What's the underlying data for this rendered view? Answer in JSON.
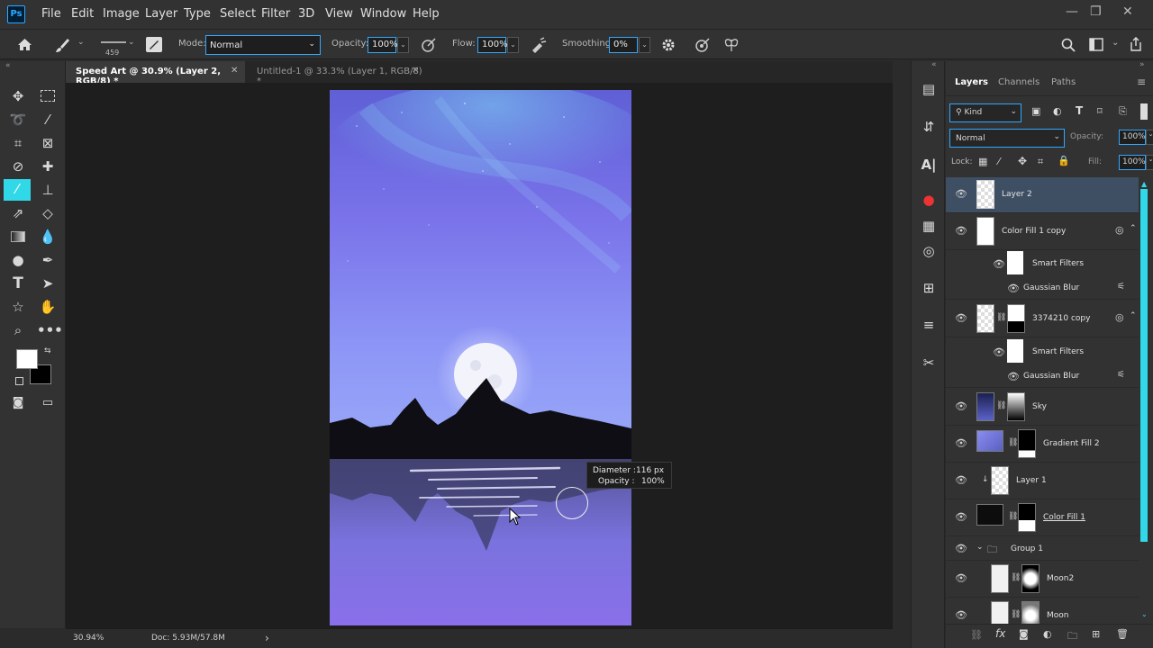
{
  "app": {
    "logo": "Ps"
  },
  "menu": [
    "File",
    "Edit",
    "Image",
    "Layer",
    "Type",
    "Select",
    "Filter",
    "3D",
    "View",
    "Window",
    "Help"
  ],
  "window_controls": {
    "minimize": "—",
    "restore": "❐",
    "close": "✕"
  },
  "options": {
    "brush_size": "459",
    "mode_label": "Mode:",
    "mode_value": "Normal",
    "opacity_label": "Opacity:",
    "opacity_value": "100%",
    "flow_label": "Flow:",
    "flow_value": "100%",
    "smoothing_label": "Smoothing:",
    "smoothing_value": "0%"
  },
  "tabs": [
    {
      "label": "Speed Art @ 30.9% (Layer 2, RGB/8) *",
      "active": true
    },
    {
      "label": "Untitled-1 @ 33.3% (Layer 1, RGB/8) *",
      "active": false
    }
  ],
  "hud": {
    "diameter_label": "Diameter :",
    "diameter_value": "116 px",
    "opacity_label": "Opacity :",
    "opacity_value": "100%"
  },
  "status": {
    "zoom": "30.94%",
    "doc": "Doc: 5.93M/57.8M",
    "arrow": "›"
  },
  "panel": {
    "tabs": [
      "Layers",
      "Channels",
      "Paths"
    ],
    "filter_kind": "Kind",
    "blend_mode": "Normal",
    "opacity_label": "Opacity:",
    "opacity_value": "100%",
    "lock_label": "Lock:",
    "fill_label": "Fill:",
    "fill_value": "100%"
  },
  "layers": [
    {
      "name": "Layer 2",
      "selected": true
    },
    {
      "name": "Color Fill 1 copy"
    },
    {
      "name": "Smart Filters"
    },
    {
      "name": "Gaussian Blur"
    },
    {
      "name": "3374210 copy"
    },
    {
      "name": "Smart Filters"
    },
    {
      "name": "Gaussian Blur"
    },
    {
      "name": "Sky"
    },
    {
      "name": "Gradient Fill 2"
    },
    {
      "name": "Layer 1"
    },
    {
      "name": "Color Fill 1"
    },
    {
      "name": "Group 1"
    },
    {
      "name": "Moon2"
    },
    {
      "name": "Moon"
    }
  ],
  "colors": {
    "accent": "#31a8ff",
    "selection": "#3e4f63",
    "scrollbar": "#31d8e8",
    "bg_dark": "#1e1e1e",
    "panel": "#323232"
  }
}
